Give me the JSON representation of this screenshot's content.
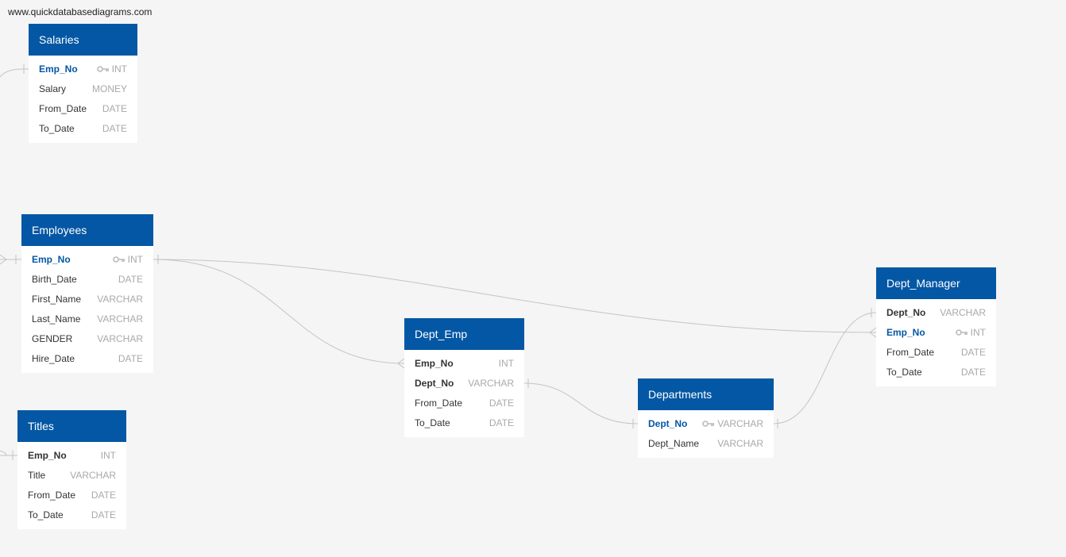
{
  "watermark": "www.quickdatabasediagrams.com",
  "colors": {
    "header": "#0457a4",
    "canvas": "#f4f5f4",
    "link": "#c4c4c4"
  },
  "tables": {
    "salaries": {
      "title": "Salaries",
      "columns": [
        {
          "name": "Emp_No",
          "type": "INT",
          "key": true
        },
        {
          "name": "Salary",
          "type": "MONEY"
        },
        {
          "name": "From_Date",
          "type": "DATE"
        },
        {
          "name": "To_Date",
          "type": "DATE"
        }
      ]
    },
    "employees": {
      "title": "Employees",
      "columns": [
        {
          "name": "Emp_No",
          "type": "INT",
          "key": true
        },
        {
          "name": "Birth_Date",
          "type": "DATE"
        },
        {
          "name": "First_Name",
          "type": "VARCHAR"
        },
        {
          "name": "Last_Name",
          "type": "VARCHAR"
        },
        {
          "name": "GENDER",
          "type": "VARCHAR"
        },
        {
          "name": "Hire_Date",
          "type": "DATE"
        }
      ]
    },
    "titles": {
      "title": "Titles",
      "columns": [
        {
          "name": "Emp_No",
          "type": "INT"
        },
        {
          "name": "Title",
          "type": "VARCHAR"
        },
        {
          "name": "From_Date",
          "type": "DATE"
        },
        {
          "name": "To_Date",
          "type": "DATE"
        }
      ]
    },
    "dept_emp": {
      "title": "Dept_Emp",
      "columns": [
        {
          "name": "Emp_No",
          "type": "INT"
        },
        {
          "name": "Dept_No",
          "type": "VARCHAR"
        },
        {
          "name": "From_Date",
          "type": "DATE"
        },
        {
          "name": "To_Date",
          "type": "DATE"
        }
      ]
    },
    "departments": {
      "title": "Departments",
      "columns": [
        {
          "name": "Dept_No",
          "type": "VARCHAR",
          "key": true
        },
        {
          "name": "Dept_Name",
          "type": "VARCHAR"
        }
      ]
    },
    "dept_manager": {
      "title": "Dept_Manager",
      "columns": [
        {
          "name": "Dept_No",
          "type": "VARCHAR"
        },
        {
          "name": "Emp_No",
          "type": "INT",
          "key": true
        },
        {
          "name": "From_Date",
          "type": "DATE"
        },
        {
          "name": "To_Date",
          "type": "DATE"
        }
      ]
    }
  }
}
